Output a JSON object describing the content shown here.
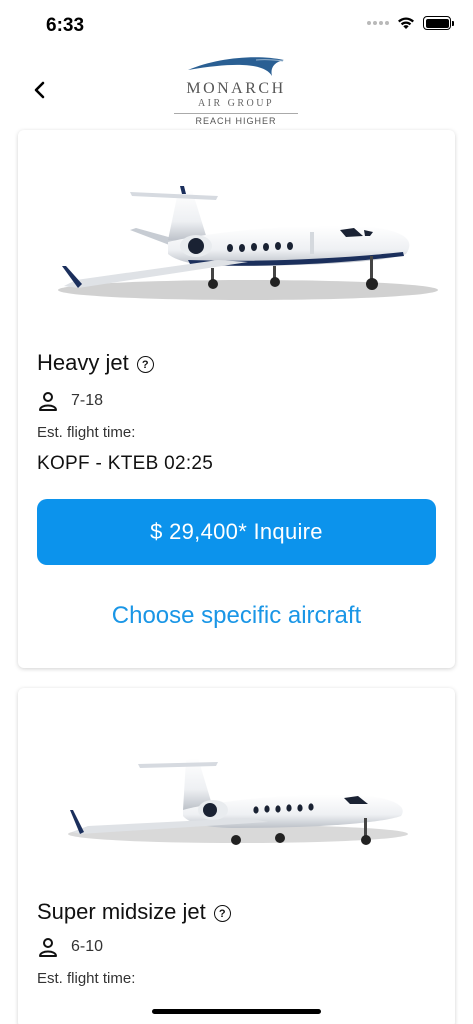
{
  "status_bar": {
    "time": "6:33",
    "icons": [
      "signal-dots-icon",
      "wifi-icon",
      "battery-icon"
    ]
  },
  "header": {
    "back_icon": "chevron-left-icon",
    "logo": {
      "name": "MONARCH",
      "sub": "AIR GROUP",
      "tagline": "REACH HIGHER"
    }
  },
  "cards": [
    {
      "title": "Heavy jet",
      "help_icon": "question-circle-icon",
      "help_glyph": "?",
      "capacity_icon": "person-icon",
      "capacity": "7-18",
      "est_label": "Est. flight time:",
      "route": "KOPF - KTEB 02:25",
      "inquire_label": "$ 29,400* Inquire",
      "choose_label": "Choose specific aircraft"
    },
    {
      "title": "Super midsize jet",
      "help_icon": "question-circle-icon",
      "help_glyph": "?",
      "capacity_icon": "person-icon",
      "capacity": "6-10",
      "est_label": "Est. flight time:"
    }
  ],
  "colors": {
    "primary_button": "#0c93ec",
    "link": "#1a96e6",
    "jet_stripe": "#1b2f5c"
  }
}
